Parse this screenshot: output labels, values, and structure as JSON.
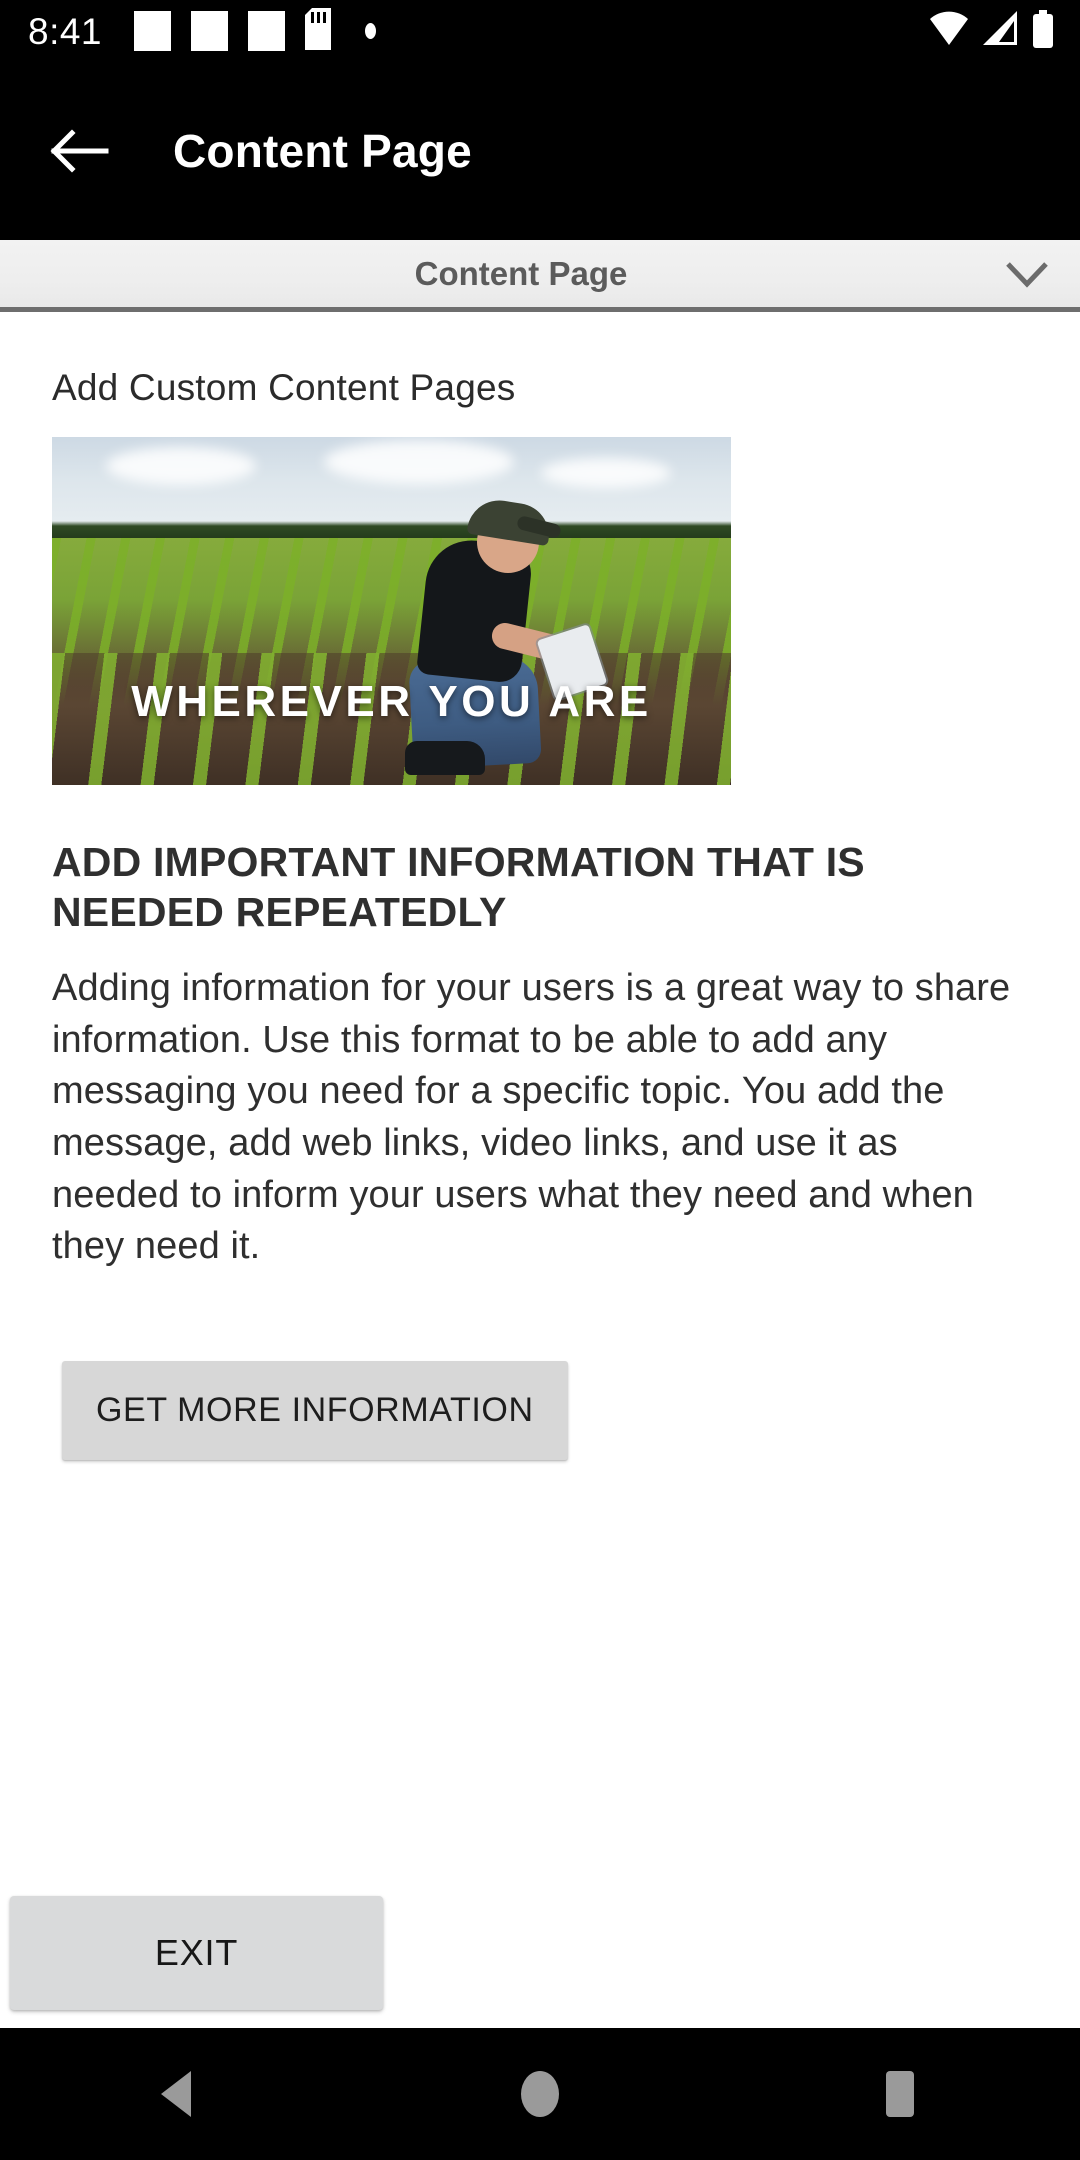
{
  "status_bar": {
    "time": "8:41",
    "left_icons": [
      "notification-square-icon",
      "notification-square-icon",
      "notification-square-icon",
      "sd-card-icon",
      "dot-icon"
    ],
    "right_icons": [
      "wifi-icon",
      "cellular-signal-icon",
      "battery-icon"
    ]
  },
  "app_bar": {
    "back_icon": "back-arrow-icon",
    "title": "Content Page"
  },
  "spinner": {
    "selected": "Content Page",
    "chevron_icon": "chevron-down-icon"
  },
  "content": {
    "section_title": "Add Custom Content Pages",
    "hero": {
      "overlay_text": "WHEREVER YOU ARE",
      "alt": "Farmer kneeling in a young corn field holding a tablet"
    },
    "body_heading": "ADD IMPORTANT INFORMATION THAT IS NEEDED REPEATEDLY",
    "body_text": "Adding information for your users is a great way to share information. Use this format to be able to add any messaging you need for a specific topic. You add the message, add web links, video links, and use it as needed to inform your users what they need and when they need it.",
    "cta_label": "GET MORE INFORMATION"
  },
  "footer": {
    "exit_label": "EXIT"
  },
  "nav_bar": {
    "back_icon": "nav-back-triangle-icon",
    "home_icon": "nav-home-circle-icon",
    "recents_icon": "nav-recents-square-icon"
  },
  "colors": {
    "app_bar_bg": "#000000",
    "spinner_bg": "#eeeeee",
    "spinner_border": "#6e6e6e",
    "button_bg": "#d7d7d7",
    "exit_bg": "#d9dadb",
    "text_primary": "#2f2f2f",
    "nav_icon": "#9a9a9a"
  }
}
